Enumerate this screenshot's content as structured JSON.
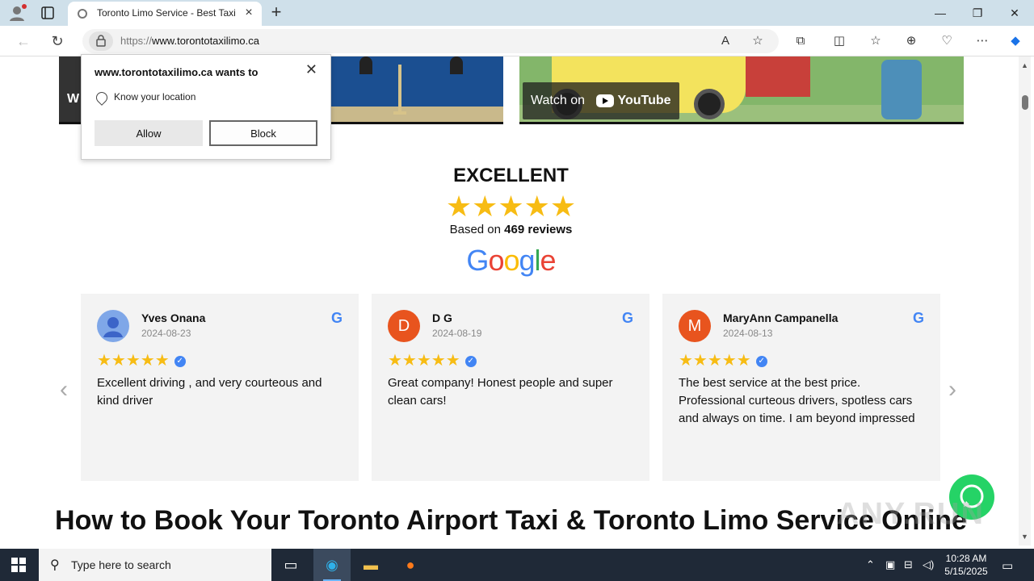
{
  "browser": {
    "tab_title": "Toronto Limo Service - Best Taxi",
    "url_scheme": "https://",
    "url_host": "www.torontotaxilimo.ca"
  },
  "permission_popup": {
    "title": "www.torontotaxilimo.ca wants to",
    "request": "Know your location",
    "allow_label": "Allow",
    "block_label": "Block"
  },
  "videos": {
    "left_label": "W",
    "watch_on": "Watch on",
    "youtube": "YouTube"
  },
  "rating": {
    "heading": "EXCELLENT",
    "stars": "★★★★★",
    "based_on_prefix": "Based on",
    "review_count_text": "469 reviews",
    "provider": "Google"
  },
  "reviews": [
    {
      "name": "Yves Onana",
      "date": "2024-08-23",
      "initial": "",
      "avatar_color": "#7fa7e8",
      "text": "Excellent driving , and very courteous and kind driver"
    },
    {
      "name": "D G",
      "date": "2024-08-19",
      "initial": "D",
      "avatar_color": "#e8541e",
      "text": "Great company! Honest people and super clean cars!"
    },
    {
      "name": "MaryAnn Campanella",
      "date": "2024-08-13",
      "initial": "M",
      "avatar_color": "#e8541e",
      "text": "The best service at the best price. Professional curteous drivers, spotless cars and always on time. I am beyond impressed"
    }
  ],
  "review_stars": "★★★★★",
  "google_g": "G",
  "howto_heading": "How to Book Your Toronto Airport Taxi & Toronto Limo Service Online",
  "watermark": "ANY.RUN",
  "taskbar": {
    "search_placeholder": "Type here to search",
    "time": "10:28 AM",
    "date": "5/15/2025"
  },
  "colors": {
    "star": "#f7bc14",
    "google_blue": "#4285f4",
    "whatsapp": "#25d366"
  }
}
